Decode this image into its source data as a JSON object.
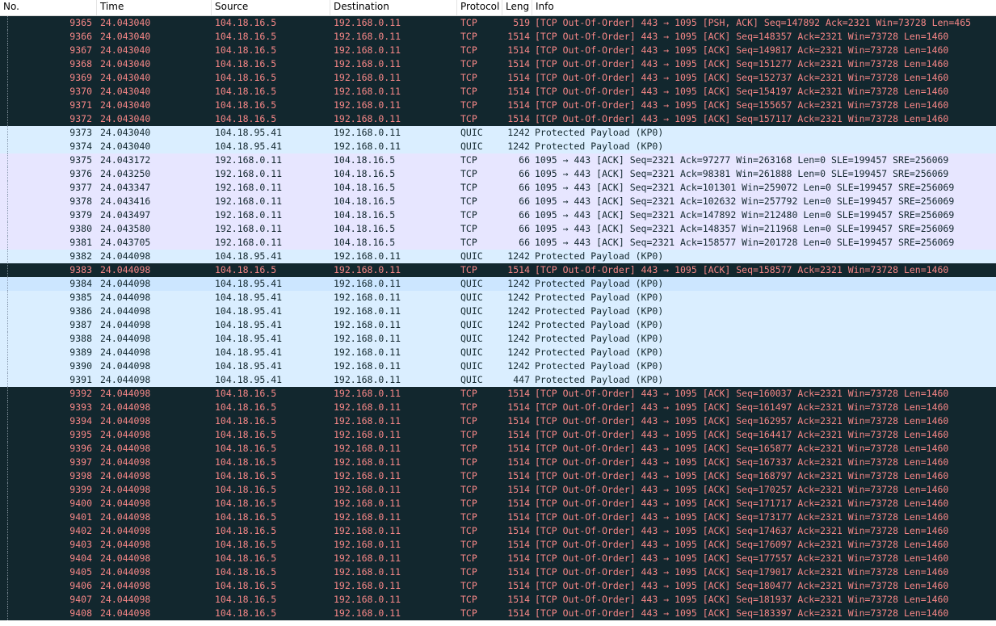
{
  "columns": {
    "no": "No.",
    "time": "Time",
    "source": "Source",
    "destination": "Destination",
    "protocol": "Protocol",
    "length": "Leng",
    "info": "Info"
  },
  "colors": {
    "tcp_out_of_order_bg": "#12272e",
    "tcp_out_of_order_fg": "#f78787",
    "quic_bg": "#daeeff",
    "tcp_ack_bg": "#e7e6ff",
    "text_dark": "#12272e"
  },
  "packets": [
    {
      "no": "9365",
      "time": "24.043040",
      "src": "104.18.16.5",
      "dst": "192.168.0.11",
      "proto": "TCP",
      "len": "519",
      "info": "[TCP Out-Of-Order] 443 → 1095 [PSH, ACK] Seq=147892 Ack=2321 Win=73728 Len=465",
      "style": "tcp-ooo"
    },
    {
      "no": "9366",
      "time": "24.043040",
      "src": "104.18.16.5",
      "dst": "192.168.0.11",
      "proto": "TCP",
      "len": "1514",
      "info": "[TCP Out-Of-Order] 443 → 1095 [ACK] Seq=148357 Ack=2321 Win=73728 Len=1460",
      "style": "tcp-ooo"
    },
    {
      "no": "9367",
      "time": "24.043040",
      "src": "104.18.16.5",
      "dst": "192.168.0.11",
      "proto": "TCP",
      "len": "1514",
      "info": "[TCP Out-Of-Order] 443 → 1095 [ACK] Seq=149817 Ack=2321 Win=73728 Len=1460",
      "style": "tcp-ooo"
    },
    {
      "no": "9368",
      "time": "24.043040",
      "src": "104.18.16.5",
      "dst": "192.168.0.11",
      "proto": "TCP",
      "len": "1514",
      "info": "[TCP Out-Of-Order] 443 → 1095 [ACK] Seq=151277 Ack=2321 Win=73728 Len=1460",
      "style": "tcp-ooo"
    },
    {
      "no": "9369",
      "time": "24.043040",
      "src": "104.18.16.5",
      "dst": "192.168.0.11",
      "proto": "TCP",
      "len": "1514",
      "info": "[TCP Out-Of-Order] 443 → 1095 [ACK] Seq=152737 Ack=2321 Win=73728 Len=1460",
      "style": "tcp-ooo"
    },
    {
      "no": "9370",
      "time": "24.043040",
      "src": "104.18.16.5",
      "dst": "192.168.0.11",
      "proto": "TCP",
      "len": "1514",
      "info": "[TCP Out-Of-Order] 443 → 1095 [ACK] Seq=154197 Ack=2321 Win=73728 Len=1460",
      "style": "tcp-ooo"
    },
    {
      "no": "9371",
      "time": "24.043040",
      "src": "104.18.16.5",
      "dst": "192.168.0.11",
      "proto": "TCP",
      "len": "1514",
      "info": "[TCP Out-Of-Order] 443 → 1095 [ACK] Seq=155657 Ack=2321 Win=73728 Len=1460",
      "style": "tcp-ooo"
    },
    {
      "no": "9372",
      "time": "24.043040",
      "src": "104.18.16.5",
      "dst": "192.168.0.11",
      "proto": "TCP",
      "len": "1514",
      "info": "[TCP Out-Of-Order] 443 → 1095 [ACK] Seq=157117 Ack=2321 Win=73728 Len=1460",
      "style": "tcp-ooo"
    },
    {
      "no": "9373",
      "time": "24.043040",
      "src": "104.18.95.41",
      "dst": "192.168.0.11",
      "proto": "QUIC",
      "len": "1242",
      "info": "Protected Payload (KP0)",
      "style": "quic"
    },
    {
      "no": "9374",
      "time": "24.043040",
      "src": "104.18.95.41",
      "dst": "192.168.0.11",
      "proto": "QUIC",
      "len": "1242",
      "info": "Protected Payload (KP0)",
      "style": "quic"
    },
    {
      "no": "9375",
      "time": "24.043172",
      "src": "192.168.0.11",
      "dst": "104.18.16.5",
      "proto": "TCP",
      "len": "66",
      "info": "1095 → 443 [ACK] Seq=2321 Ack=97277 Win=263168 Len=0 SLE=199457 SRE=256069",
      "style": "ack"
    },
    {
      "no": "9376",
      "time": "24.043250",
      "src": "192.168.0.11",
      "dst": "104.18.16.5",
      "proto": "TCP",
      "len": "66",
      "info": "1095 → 443 [ACK] Seq=2321 Ack=98381 Win=261888 Len=0 SLE=199457 SRE=256069",
      "style": "ack"
    },
    {
      "no": "9377",
      "time": "24.043347",
      "src": "192.168.0.11",
      "dst": "104.18.16.5",
      "proto": "TCP",
      "len": "66",
      "info": "1095 → 443 [ACK] Seq=2321 Ack=101301 Win=259072 Len=0 SLE=199457 SRE=256069",
      "style": "ack"
    },
    {
      "no": "9378",
      "time": "24.043416",
      "src": "192.168.0.11",
      "dst": "104.18.16.5",
      "proto": "TCP",
      "len": "66",
      "info": "1095 → 443 [ACK] Seq=2321 Ack=102632 Win=257792 Len=0 SLE=199457 SRE=256069",
      "style": "ack"
    },
    {
      "no": "9379",
      "time": "24.043497",
      "src": "192.168.0.11",
      "dst": "104.18.16.5",
      "proto": "TCP",
      "len": "66",
      "info": "1095 → 443 [ACK] Seq=2321 Ack=147892 Win=212480 Len=0 SLE=199457 SRE=256069",
      "style": "ack"
    },
    {
      "no": "9380",
      "time": "24.043580",
      "src": "192.168.0.11",
      "dst": "104.18.16.5",
      "proto": "TCP",
      "len": "66",
      "info": "1095 → 443 [ACK] Seq=2321 Ack=148357 Win=211968 Len=0 SLE=199457 SRE=256069",
      "style": "ack"
    },
    {
      "no": "9381",
      "time": "24.043705",
      "src": "192.168.0.11",
      "dst": "104.18.16.5",
      "proto": "TCP",
      "len": "66",
      "info": "1095 → 443 [ACK] Seq=2321 Ack=158577 Win=201728 Len=0 SLE=199457 SRE=256069",
      "style": "ack"
    },
    {
      "no": "9382",
      "time": "24.044098",
      "src": "104.18.95.41",
      "dst": "192.168.0.11",
      "proto": "QUIC",
      "len": "1242",
      "info": "Protected Payload (KP0)",
      "style": "quic"
    },
    {
      "no": "9383",
      "time": "24.044098",
      "src": "104.18.16.5",
      "dst": "192.168.0.11",
      "proto": "TCP",
      "len": "1514",
      "info": "[TCP Out-Of-Order] 443 → 1095 [ACK] Seq=158577 Ack=2321 Win=73728 Len=1460",
      "style": "selected-ooo"
    },
    {
      "no": "9384",
      "time": "24.044098",
      "src": "104.18.95.41",
      "dst": "192.168.0.11",
      "proto": "QUIC",
      "len": "1242",
      "info": "Protected Payload (KP0)",
      "style": "selected-quic"
    },
    {
      "no": "9385",
      "time": "24.044098",
      "src": "104.18.95.41",
      "dst": "192.168.0.11",
      "proto": "QUIC",
      "len": "1242",
      "info": "Protected Payload (KP0)",
      "style": "quic"
    },
    {
      "no": "9386",
      "time": "24.044098",
      "src": "104.18.95.41",
      "dst": "192.168.0.11",
      "proto": "QUIC",
      "len": "1242",
      "info": "Protected Payload (KP0)",
      "style": "quic"
    },
    {
      "no": "9387",
      "time": "24.044098",
      "src": "104.18.95.41",
      "dst": "192.168.0.11",
      "proto": "QUIC",
      "len": "1242",
      "info": "Protected Payload (KP0)",
      "style": "quic"
    },
    {
      "no": "9388",
      "time": "24.044098",
      "src": "104.18.95.41",
      "dst": "192.168.0.11",
      "proto": "QUIC",
      "len": "1242",
      "info": "Protected Payload (KP0)",
      "style": "quic"
    },
    {
      "no": "9389",
      "time": "24.044098",
      "src": "104.18.95.41",
      "dst": "192.168.0.11",
      "proto": "QUIC",
      "len": "1242",
      "info": "Protected Payload (KP0)",
      "style": "quic"
    },
    {
      "no": "9390",
      "time": "24.044098",
      "src": "104.18.95.41",
      "dst": "192.168.0.11",
      "proto": "QUIC",
      "len": "1242",
      "info": "Protected Payload (KP0)",
      "style": "quic"
    },
    {
      "no": "9391",
      "time": "24.044098",
      "src": "104.18.95.41",
      "dst": "192.168.0.11",
      "proto": "QUIC",
      "len": "447",
      "info": "Protected Payload (KP0)",
      "style": "quic"
    },
    {
      "no": "9392",
      "time": "24.044098",
      "src": "104.18.16.5",
      "dst": "192.168.0.11",
      "proto": "TCP",
      "len": "1514",
      "info": "[TCP Out-Of-Order] 443 → 1095 [ACK] Seq=160037 Ack=2321 Win=73728 Len=1460",
      "style": "tcp-ooo"
    },
    {
      "no": "9393",
      "time": "24.044098",
      "src": "104.18.16.5",
      "dst": "192.168.0.11",
      "proto": "TCP",
      "len": "1514",
      "info": "[TCP Out-Of-Order] 443 → 1095 [ACK] Seq=161497 Ack=2321 Win=73728 Len=1460",
      "style": "tcp-ooo"
    },
    {
      "no": "9394",
      "time": "24.044098",
      "src": "104.18.16.5",
      "dst": "192.168.0.11",
      "proto": "TCP",
      "len": "1514",
      "info": "[TCP Out-Of-Order] 443 → 1095 [ACK] Seq=162957 Ack=2321 Win=73728 Len=1460",
      "style": "tcp-ooo"
    },
    {
      "no": "9395",
      "time": "24.044098",
      "src": "104.18.16.5",
      "dst": "192.168.0.11",
      "proto": "TCP",
      "len": "1514",
      "info": "[TCP Out-Of-Order] 443 → 1095 [ACK] Seq=164417 Ack=2321 Win=73728 Len=1460",
      "style": "tcp-ooo"
    },
    {
      "no": "9396",
      "time": "24.044098",
      "src": "104.18.16.5",
      "dst": "192.168.0.11",
      "proto": "TCP",
      "len": "1514",
      "info": "[TCP Out-Of-Order] 443 → 1095 [ACK] Seq=165877 Ack=2321 Win=73728 Len=1460",
      "style": "tcp-ooo"
    },
    {
      "no": "9397",
      "time": "24.044098",
      "src": "104.18.16.5",
      "dst": "192.168.0.11",
      "proto": "TCP",
      "len": "1514",
      "info": "[TCP Out-Of-Order] 443 → 1095 [ACK] Seq=167337 Ack=2321 Win=73728 Len=1460",
      "style": "tcp-ooo"
    },
    {
      "no": "9398",
      "time": "24.044098",
      "src": "104.18.16.5",
      "dst": "192.168.0.11",
      "proto": "TCP",
      "len": "1514",
      "info": "[TCP Out-Of-Order] 443 → 1095 [ACK] Seq=168797 Ack=2321 Win=73728 Len=1460",
      "style": "tcp-ooo"
    },
    {
      "no": "9399",
      "time": "24.044098",
      "src": "104.18.16.5",
      "dst": "192.168.0.11",
      "proto": "TCP",
      "len": "1514",
      "info": "[TCP Out-Of-Order] 443 → 1095 [ACK] Seq=170257 Ack=2321 Win=73728 Len=1460",
      "style": "tcp-ooo"
    },
    {
      "no": "9400",
      "time": "24.044098",
      "src": "104.18.16.5",
      "dst": "192.168.0.11",
      "proto": "TCP",
      "len": "1514",
      "info": "[TCP Out-Of-Order] 443 → 1095 [ACK] Seq=171717 Ack=2321 Win=73728 Len=1460",
      "style": "tcp-ooo"
    },
    {
      "no": "9401",
      "time": "24.044098",
      "src": "104.18.16.5",
      "dst": "192.168.0.11",
      "proto": "TCP",
      "len": "1514",
      "info": "[TCP Out-Of-Order] 443 → 1095 [ACK] Seq=173177 Ack=2321 Win=73728 Len=1460",
      "style": "tcp-ooo"
    },
    {
      "no": "9402",
      "time": "24.044098",
      "src": "104.18.16.5",
      "dst": "192.168.0.11",
      "proto": "TCP",
      "len": "1514",
      "info": "[TCP Out-Of-Order] 443 → 1095 [ACK] Seq=174637 Ack=2321 Win=73728 Len=1460",
      "style": "tcp-ooo"
    },
    {
      "no": "9403",
      "time": "24.044098",
      "src": "104.18.16.5",
      "dst": "192.168.0.11",
      "proto": "TCP",
      "len": "1514",
      "info": "[TCP Out-Of-Order] 443 → 1095 [ACK] Seq=176097 Ack=2321 Win=73728 Len=1460",
      "style": "tcp-ooo"
    },
    {
      "no": "9404",
      "time": "24.044098",
      "src": "104.18.16.5",
      "dst": "192.168.0.11",
      "proto": "TCP",
      "len": "1514",
      "info": "[TCP Out-Of-Order] 443 → 1095 [ACK] Seq=177557 Ack=2321 Win=73728 Len=1460",
      "style": "tcp-ooo"
    },
    {
      "no": "9405",
      "time": "24.044098",
      "src": "104.18.16.5",
      "dst": "192.168.0.11",
      "proto": "TCP",
      "len": "1514",
      "info": "[TCP Out-Of-Order] 443 → 1095 [ACK] Seq=179017 Ack=2321 Win=73728 Len=1460",
      "style": "tcp-ooo"
    },
    {
      "no": "9406",
      "time": "24.044098",
      "src": "104.18.16.5",
      "dst": "192.168.0.11",
      "proto": "TCP",
      "len": "1514",
      "info": "[TCP Out-Of-Order] 443 → 1095 [ACK] Seq=180477 Ack=2321 Win=73728 Len=1460",
      "style": "tcp-ooo"
    },
    {
      "no": "9407",
      "time": "24.044098",
      "src": "104.18.16.5",
      "dst": "192.168.0.11",
      "proto": "TCP",
      "len": "1514",
      "info": "[TCP Out-Of-Order] 443 → 1095 [ACK] Seq=181937 Ack=2321 Win=73728 Len=1460",
      "style": "tcp-ooo"
    },
    {
      "no": "9408",
      "time": "24.044098",
      "src": "104.18.16.5",
      "dst": "192.168.0.11",
      "proto": "TCP",
      "len": "1514",
      "info": "[TCP Out-Of-Order] 443 → 1095 [ACK] Seq=183397 Ack=2321 Win=73728 Len=1460",
      "style": "tcp-ooo"
    }
  ]
}
